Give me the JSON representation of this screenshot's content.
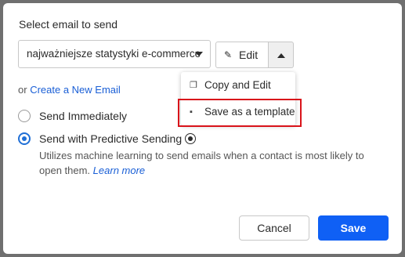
{
  "dialog": {
    "select_label": "Select email to send",
    "selected_email": "najważniejsze statystyki e-commerce",
    "edit_label": "Edit",
    "or_text": "or",
    "create_link": "Create a New Email"
  },
  "menu": {
    "items": [
      {
        "label": "Copy and Edit",
        "icon": "copy-icon"
      },
      {
        "label": "Save as a template",
        "icon": "template-icon"
      }
    ]
  },
  "options": {
    "immediate": {
      "label": "Send Immediately",
      "selected": false
    },
    "predictive": {
      "label": "Send with Predictive Sending",
      "selected": true,
      "description": "Utilizes machine learning to send emails when a contact is most likely to open them.",
      "learn_more": "Learn more"
    }
  },
  "footer": {
    "cancel_label": "Cancel",
    "save_label": "Save"
  },
  "colors": {
    "accent": "#0f60f5",
    "link": "#1a5fd6",
    "highlight": "#d9131a"
  }
}
